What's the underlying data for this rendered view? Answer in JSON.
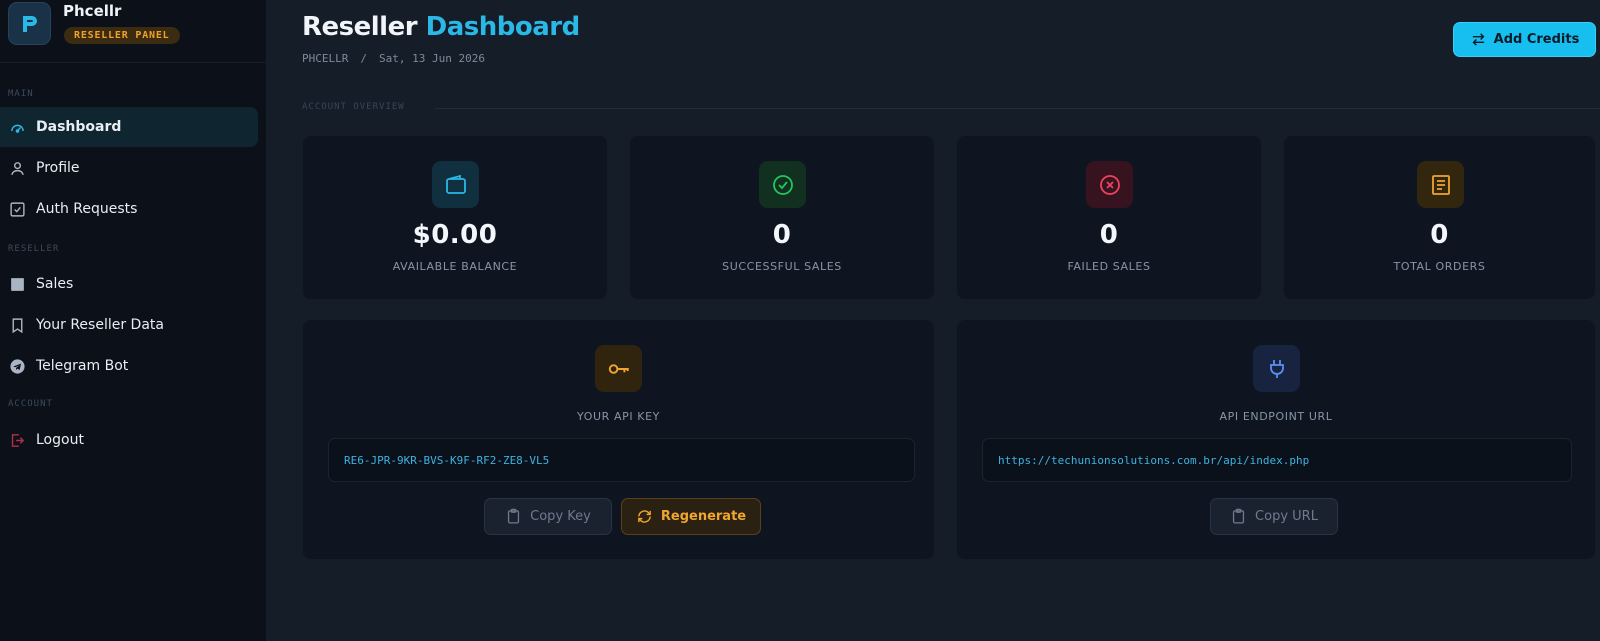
{
  "brand": {
    "name": "Phcellr",
    "badge": "RESELLER PANEL",
    "logo_letter": "P"
  },
  "nav": {
    "sections": [
      {
        "label": "MAIN"
      },
      {
        "label": "RESELLER"
      },
      {
        "label": "ACCOUNT"
      }
    ],
    "items": [
      {
        "label": "Dashboard",
        "icon": "dashboard-gauge-icon",
        "active": true
      },
      {
        "label": "Profile",
        "icon": "user-icon"
      },
      {
        "label": "Auth Requests",
        "icon": "checkbox-icon"
      },
      {
        "label": "Sales",
        "icon": "square-icon"
      },
      {
        "label": "Your Reseller Data",
        "icon": "bookmark-icon"
      },
      {
        "label": "Telegram Bot",
        "icon": "telegram-icon"
      },
      {
        "label": "Logout",
        "icon": "logout-icon"
      }
    ]
  },
  "header": {
    "title_part1": "Reseller",
    "title_part2": "Dashboard",
    "breadcrumb_root": "PHCELLR",
    "breadcrumb_sep": "/",
    "date": "Sat, 13 Jun 2026",
    "add_credits_label": "Add Credits"
  },
  "overview": {
    "section_label": "ACCOUNT OVERVIEW",
    "stats": [
      {
        "value": "$0.00",
        "label": "AVAILABLE BALANCE",
        "icon": "wallet-icon",
        "color": "#2bb8e6"
      },
      {
        "value": "0",
        "label": "SUCCESSFUL SALES",
        "icon": "check-circle-icon",
        "color": "#22c55e"
      },
      {
        "value": "0",
        "label": "FAILED SALES",
        "icon": "x-circle-icon",
        "color": "#f0425f"
      },
      {
        "value": "0",
        "label": "TOTAL ORDERS",
        "icon": "receipt-icon",
        "color": "#f0a530"
      }
    ]
  },
  "api_key": {
    "label": "YOUR API KEY",
    "value": "RE6-JPR-9KR-BVS-K9F-RF2-ZE8-VL5",
    "copy_label": "Copy Key",
    "regenerate_label": "Regenerate"
  },
  "api_endpoint": {
    "label": "API ENDPOINT URL",
    "value": "https://techunionsolutions.com.br/api/index.php",
    "copy_label": "Copy URL"
  },
  "colors": {
    "accent": "#16bff0",
    "background": "#151d29",
    "sidebar": "#0b1019",
    "card": "#0e1520",
    "warning": "#f0a530"
  }
}
